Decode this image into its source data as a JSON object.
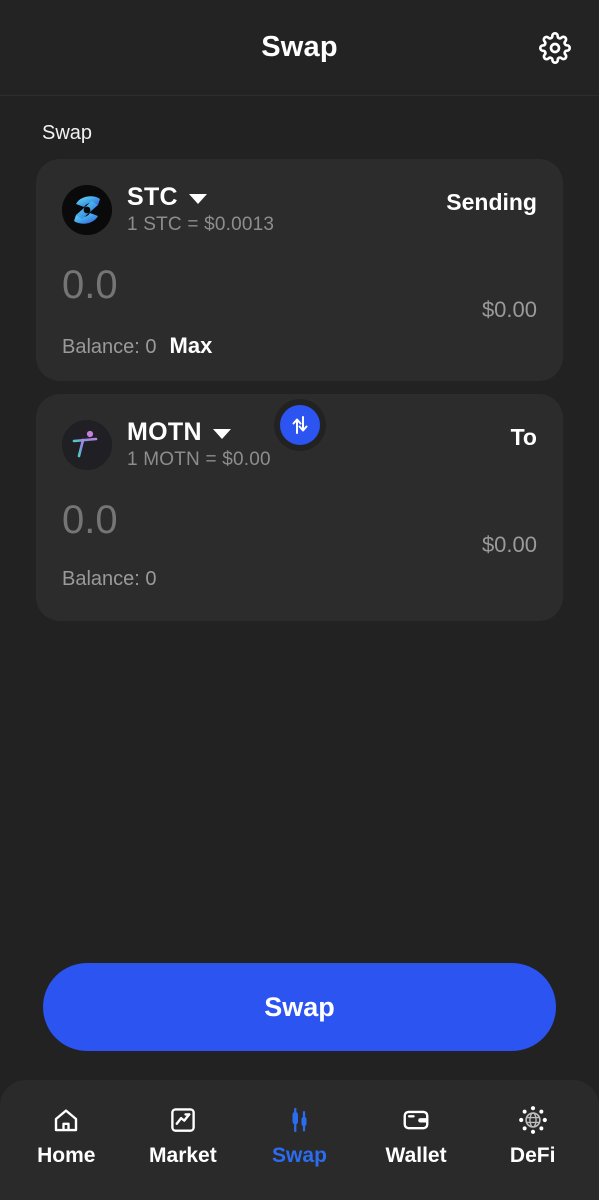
{
  "header": {
    "title": "Swap",
    "settings_icon": "gear-icon"
  },
  "section": {
    "label": "Swap"
  },
  "from_card": {
    "side_label": "Sending",
    "token_symbol": "STC",
    "token_icon": "stc-token-icon",
    "rate": "1 STC = $0.0013",
    "amount_value": "0.0",
    "amount_placeholder": "0.0",
    "fiat_value": "$0.00",
    "balance_text": "Balance: 0",
    "max_label": "Max"
  },
  "to_card": {
    "side_label": "To",
    "token_symbol": "MOTN",
    "token_icon": "motn-token-icon",
    "rate": "1 MOTN = $0.00",
    "amount_value": "0.0",
    "amount_placeholder": "0.0",
    "fiat_value": "$0.00",
    "balance_text": "Balance: 0"
  },
  "switch_button": {
    "icon": "swap-vertical-arrows-icon"
  },
  "primary_action": {
    "label": "Swap"
  },
  "bottom_nav": {
    "items": [
      {
        "label": "Home",
        "icon": "home-icon",
        "active": false
      },
      {
        "label": "Market",
        "icon": "chart-box-icon",
        "active": false
      },
      {
        "label": "Swap",
        "icon": "candlestick-icon",
        "active": true
      },
      {
        "label": "Wallet",
        "icon": "wallet-icon",
        "active": false
      },
      {
        "label": "DeFi",
        "icon": "globe-network-icon",
        "active": false
      }
    ]
  },
  "colors": {
    "accent": "#2b54f0",
    "active_nav": "#2b6cf0",
    "page_background": "#222222",
    "card_background": "#2c2c2c",
    "muted_text": "#9a9a9a"
  }
}
